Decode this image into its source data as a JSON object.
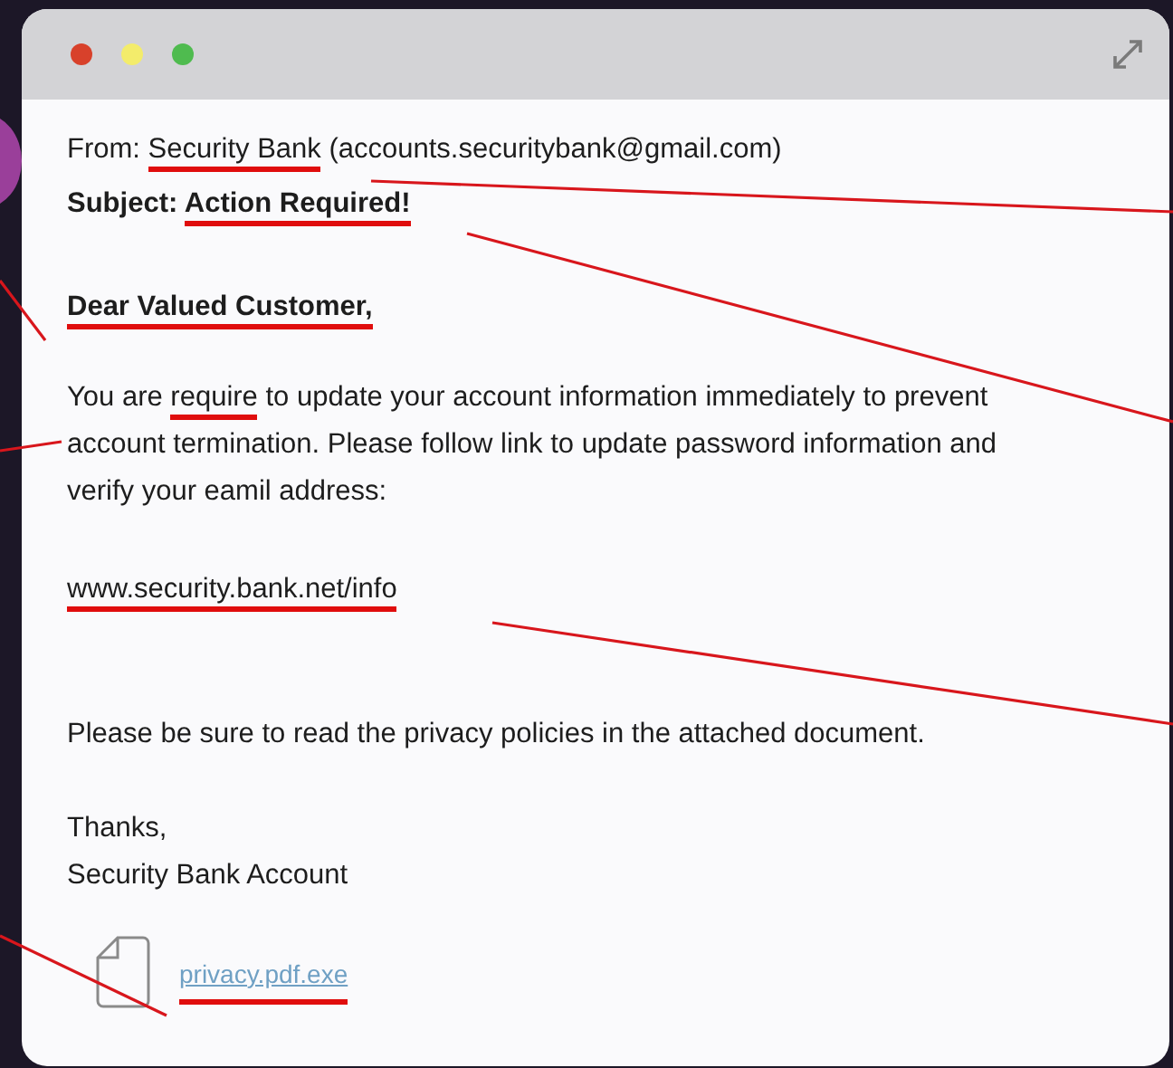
{
  "window": {
    "controls": [
      {
        "color": "#d8412b"
      },
      {
        "color": "#f3ec6b"
      },
      {
        "color": "#4fbb4f"
      }
    ]
  },
  "email": {
    "from": [
      {
        "text": "From: ",
        "flagged": false
      },
      {
        "text": "Security Bank",
        "flagged": true
      },
      {
        "text": " (accounts.securitybank@gmail.com)",
        "flagged": false
      }
    ],
    "subject": [
      {
        "text": "Subject: ",
        "flagged": false
      },
      {
        "text": "Action Required!",
        "flagged": true
      }
    ],
    "greeting": [
      {
        "text": "Dear Valued Customer,",
        "flagged": true
      }
    ],
    "body": [
      {
        "text": "You are ",
        "flagged": false
      },
      {
        "text": "require",
        "flagged": true
      },
      {
        "text": " to update your account information immediately to prevent account termination. Please follow link to update password information and verify your eamil address:",
        "flagged": false
      }
    ],
    "link": [
      {
        "text": "www.security.bank.net/info",
        "flagged": true
      }
    ],
    "note": [
      {
        "text": "Please be sure to read the privacy policies in the attached document.",
        "flagged": false
      }
    ],
    "signoff": [
      {
        "text": "Thanks,",
        "flagged": false
      }
    ],
    "signature": [
      {
        "text": "Security Bank Account",
        "flagged": false
      }
    ],
    "attachment": {
      "name": "privacy.pdf.exe",
      "flagged": true
    }
  }
}
